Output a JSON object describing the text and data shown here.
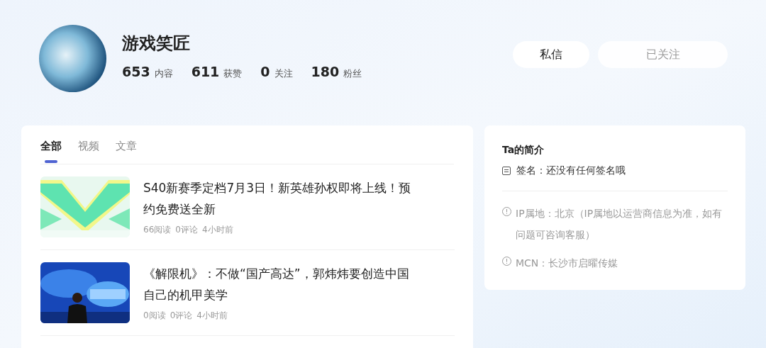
{
  "profile": {
    "name": "游戏笑匠",
    "stats": [
      {
        "value": "653",
        "label": "内容"
      },
      {
        "value": "611",
        "label": "获赞"
      },
      {
        "value": "0",
        "label": "关注"
      },
      {
        "value": "180",
        "label": "粉丝"
      }
    ]
  },
  "actions": {
    "message": "私信",
    "follow": {
      "label": "已关注",
      "following": true
    }
  },
  "tabs": [
    {
      "label": "全部",
      "selected": true
    },
    {
      "label": "视频",
      "selected": false
    },
    {
      "label": "文章",
      "selected": false
    }
  ],
  "articles": [
    {
      "title": "S40新赛季定档7月3日！新英雄孙权即将上线！预约免费送全新",
      "meta": [
        "66阅读",
        "0评论",
        "4小时前"
      ]
    },
    {
      "title": "《解限机》：不做“国产高达”，郭炜炜要创造中国自己的机甲美学",
      "meta": [
        "0阅读",
        "0评论",
        "4小时前"
      ]
    }
  ],
  "intro": {
    "title": "Ta的简介",
    "signature": "签名：还没有任何签名哦",
    "notes": [
      "IP属地：北京（IP属地以运营商信息为准，如有问题可咨询客服）",
      "MCN：长沙市启曜传媒"
    ]
  }
}
